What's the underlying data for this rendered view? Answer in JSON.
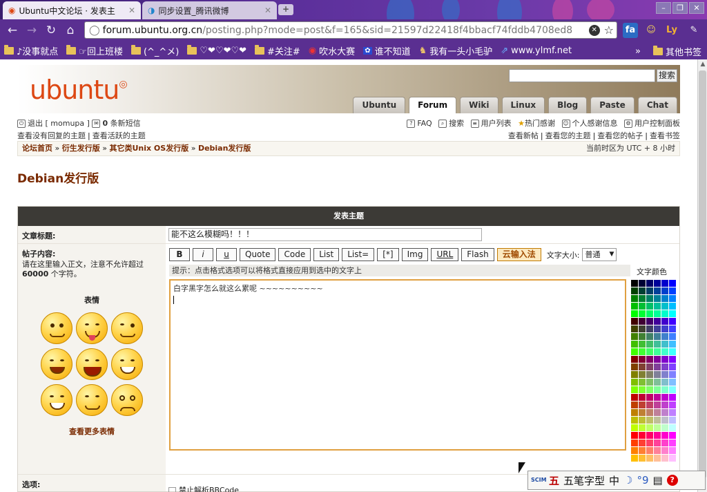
{
  "browser": {
    "tabs": [
      {
        "label": "Ubuntu中文论坛 · 发表主",
        "active": true
      },
      {
        "label": "同步设置_腾讯微博",
        "active": false
      }
    ],
    "address": {
      "domain": "forum.ubuntu.org.cn",
      "path": "/posting.php?mode=post&f=165&sid=21597d22418f4bbacf74fddb4708ed8"
    },
    "bookmarks": [
      {
        "label": "♪没事就点",
        "icon": "folder"
      },
      {
        "label": "☞回上班楼",
        "icon": "folder"
      },
      {
        "label": "(^_^メ)",
        "icon": "folder"
      },
      {
        "label": "♡❤♡❤♡❤",
        "icon": "folder"
      },
      {
        "label": "#关注#",
        "icon": "folder"
      },
      {
        "label": "吹水大赛",
        "icon": "weibo-icon"
      },
      {
        "label": "谁不知道",
        "icon": "paw-icon"
      },
      {
        "label": "我有一头小毛驴",
        "icon": "donkey-icon"
      },
      {
        "label": "www.ylmf.net",
        "icon": "ylmf-icon"
      }
    ],
    "other_bookmarks": "其他书签",
    "ext_fa": "fa",
    "ext_ly": "Ly"
  },
  "site": {
    "logo_text": "ubuntu",
    "search_button": "搜索",
    "nav_tabs": [
      {
        "label": "Ubuntu",
        "active": false
      },
      {
        "label": "Forum",
        "active": true
      },
      {
        "label": "Wiki",
        "active": false
      },
      {
        "label": "Linux",
        "active": false
      },
      {
        "label": "Blog",
        "active": false
      },
      {
        "label": "Paste",
        "active": false
      },
      {
        "label": "Chat",
        "active": false
      }
    ]
  },
  "userbar": {
    "logout": "退出 [ momupa ]",
    "pm_count": "0",
    "pm_label": "条新短信",
    "unanswered": "查看没有回复的主题",
    "active_topics": "查看活跃的主题",
    "faq": "FAQ",
    "search": "搜索",
    "memberlist": "用户列表",
    "thanks": "热门感谢",
    "my_thanks": "个人感谢信息",
    "ucp": "用户控制面板",
    "new_posts": "查看新帖",
    "your_topics": "查看您的主题",
    "your_posts": "查看您的帖子",
    "bookmarks": "查看书签"
  },
  "breadcrumb": {
    "items": [
      "论坛首页",
      "衍生发行版",
      "其它类Unix OS发行版",
      "Debian发行版"
    ],
    "timezone": "当前时区为 UTC + 8 小时"
  },
  "forum_title": "Debian发行版",
  "post": {
    "header": "发表主题",
    "subject_label": "文章标题:",
    "subject_value": "能不这么模糊吗！！！",
    "content_label": "帖子内容:",
    "content_hint_a": "请在这里输入正文，注意不允许超过",
    "content_limit": "60000",
    "content_hint_b": "个字符。",
    "smilies_title": "表情",
    "more_smilies": "查看更多表情",
    "toolbar": {
      "bold": "B",
      "italic": "i",
      "underline": "u",
      "quote": "Quote",
      "code": "Code",
      "list": "List",
      "list_eq": "List=",
      "list_item": "[*]",
      "img": "Img",
      "url": "URL",
      "flash": "Flash",
      "yun": "云输入法",
      "size_label": "文字大小:",
      "size_value": "普通"
    },
    "format_hint": "提示：点击格式选项可以将格式直接应用到选中的文字上",
    "body_text": "白字黑字怎么就这么累呢 ~~~~~~~~~~",
    "color_title": "文字颜色",
    "options_label": "选项:",
    "option_bbcode": "禁止解析BBCode"
  },
  "ime": {
    "logo": "SCIM",
    "wu": "五",
    "name": "五笔字型",
    "zh": "中",
    "moon": "☽",
    "punct": "°9",
    "kb": "▤",
    "help": "?"
  }
}
